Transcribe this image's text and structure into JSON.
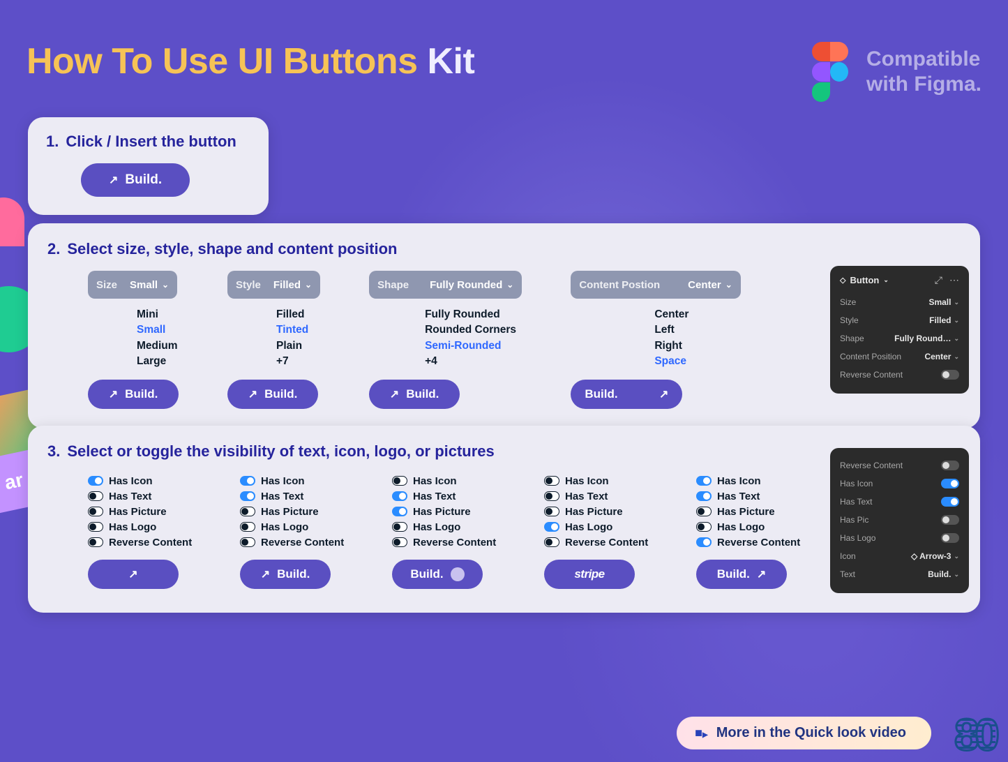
{
  "title": {
    "part1": "How To Use UI Buttons",
    "part2": "Kit"
  },
  "figma_badge": {
    "line1": "Compatible",
    "line2": "with Figma."
  },
  "step1": {
    "label": "1.",
    "text": "Click / Insert the button",
    "button": "Build."
  },
  "step2": {
    "label": "2.",
    "text": "Select size, style, shape and content position",
    "props": [
      {
        "name": "Size",
        "value": "Small",
        "options": [
          "Mini",
          "Small",
          "Medium",
          "Large"
        ],
        "selected": "Small",
        "button": "↗ Build."
      },
      {
        "name": "Style",
        "value": "Filled",
        "options": [
          "Filled",
          "Tinted",
          "Plain",
          "+7"
        ],
        "selected": "Tinted",
        "button": "↗ Build."
      },
      {
        "name": "Shape",
        "value": "Fully Rounded",
        "options": [
          "Fully Rounded",
          "Rounded Corners",
          "Semi-Rounded",
          "+4"
        ],
        "selected": "Semi-Rounded",
        "button": "↗ Build."
      },
      {
        "name": "Content Postion",
        "value": "Center",
        "options": [
          "Center",
          "Left",
          "Right",
          "Space"
        ],
        "selected": "Space",
        "button": "Build."
      }
    ],
    "panel": {
      "title": "Button",
      "rows": [
        {
          "k": "Size",
          "v": "Small"
        },
        {
          "k": "Style",
          "v": "Filled"
        },
        {
          "k": "Shape",
          "v": "Fully Round…"
        },
        {
          "k": "Content Position",
          "v": "Center"
        },
        {
          "k": "Reverse Content",
          "toggle": false
        }
      ]
    }
  },
  "step3": {
    "label": "3.",
    "text": "Select or toggle the visibility of text, icon, logo, or pictures",
    "columns": [
      {
        "toggles": [
          {
            "label": "Has Icon",
            "on": true
          },
          {
            "label": "Has Text",
            "on": false
          },
          {
            "label": "Has Picture",
            "on": false
          },
          {
            "label": "Has Logo",
            "on": false
          },
          {
            "label": "Reverse Content",
            "on": false
          }
        ],
        "button": "↗"
      },
      {
        "toggles": [
          {
            "label": "Has Icon",
            "on": true
          },
          {
            "label": "Has Text",
            "on": true
          },
          {
            "label": "Has Picture",
            "on": false
          },
          {
            "label": "Has Logo",
            "on": false
          },
          {
            "label": "Reverse Content",
            "on": false
          }
        ],
        "button": "↗ Build."
      },
      {
        "toggles": [
          {
            "label": "Has Icon",
            "on": false
          },
          {
            "label": "Has Text",
            "on": true
          },
          {
            "label": "Has Picture",
            "on": true
          },
          {
            "label": "Has Logo",
            "on": false
          },
          {
            "label": "Reverse Content",
            "on": false
          }
        ],
        "button": "Build.",
        "avatar": true
      },
      {
        "toggles": [
          {
            "label": "Has Icon",
            "on": false
          },
          {
            "label": "Has Text",
            "on": false
          },
          {
            "label": "Has Picture",
            "on": false
          },
          {
            "label": "Has Logo",
            "on": true
          },
          {
            "label": "Reverse Content",
            "on": false
          }
        ],
        "button": "stripe",
        "stripe": true
      },
      {
        "toggles": [
          {
            "label": "Has Icon",
            "on": true
          },
          {
            "label": "Has Text",
            "on": true
          },
          {
            "label": "Has Picture",
            "on": false
          },
          {
            "label": "Has Logo",
            "on": false
          },
          {
            "label": "Reverse Content",
            "on": true
          }
        ],
        "button": "Build. ↗"
      }
    ],
    "panel": {
      "rows": [
        {
          "k": "Reverse Content",
          "toggle": false
        },
        {
          "k": "Has Icon",
          "toggle": true
        },
        {
          "k": "Has Text",
          "toggle": true
        },
        {
          "k": "Has Pic",
          "toggle": false
        },
        {
          "k": "Has Logo",
          "toggle": false
        },
        {
          "k": "Icon",
          "v": "◇ Arrow-3"
        },
        {
          "k": "Text",
          "v": "Build."
        }
      ]
    }
  },
  "footer": {
    "text": "More in the Quick look video"
  },
  "logo": "80"
}
